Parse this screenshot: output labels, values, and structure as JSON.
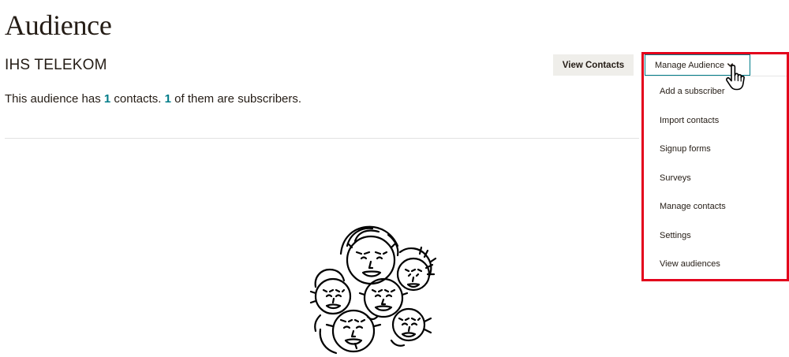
{
  "page": {
    "title": "Audience",
    "audience_name": "IHS TELEKOM",
    "summary": {
      "prefix": "This audience has ",
      "contacts_count": "1",
      "middle": " contacts. ",
      "subscribers_count": "1",
      "suffix": " of them are subscribers."
    }
  },
  "toolbar": {
    "view_contacts_label": "View Contacts",
    "manage_audience_label": "Manage Audience"
  },
  "dropdown": {
    "items": [
      "Add a subscriber",
      "Import contacts",
      "Signup forms",
      "Surveys",
      "Manage contacts",
      "Settings",
      "View audiences"
    ]
  },
  "colors": {
    "accent": "#007c89",
    "highlight": "#e3001b",
    "text": "#241c15",
    "secondary_button_bg": "#efeeea"
  },
  "icons": {
    "dropdown_chevron": "chevron-down-icon",
    "cursor": "hand-pointer-icon",
    "illustration": "group-of-faces-illustration"
  }
}
